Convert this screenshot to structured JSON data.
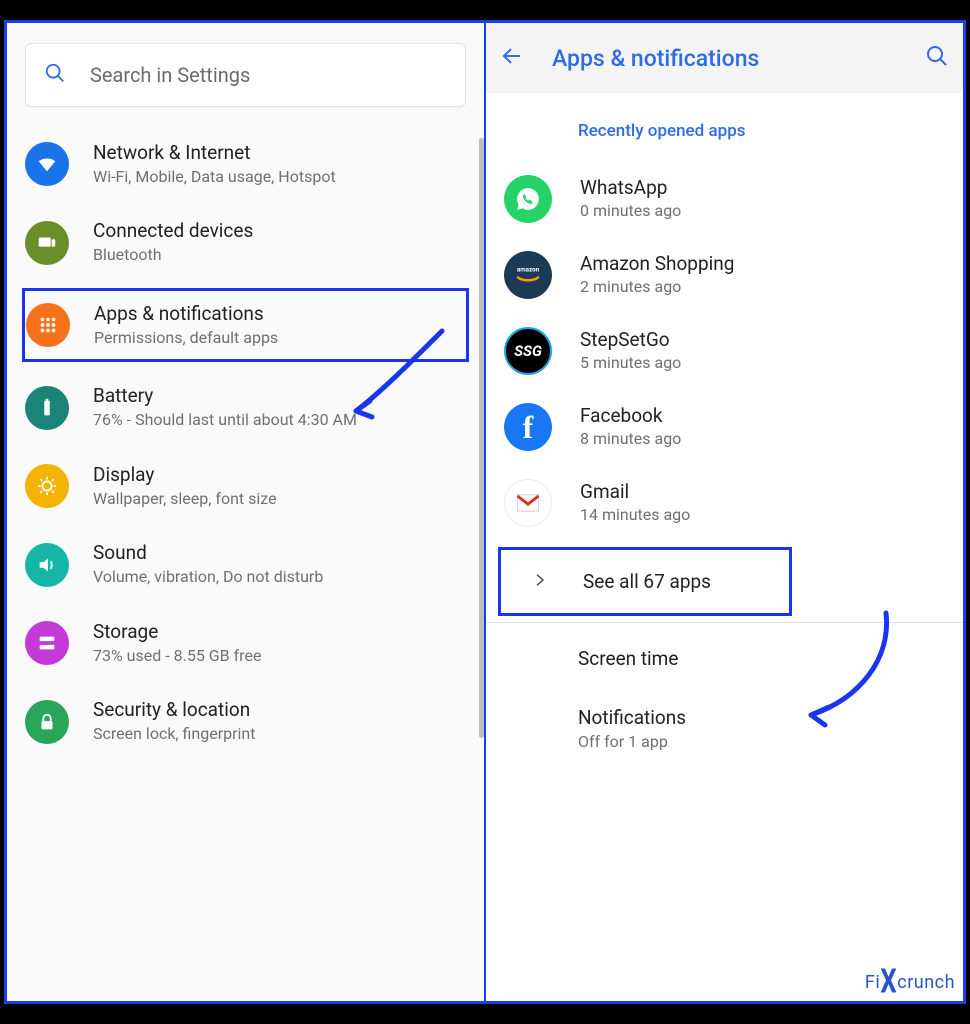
{
  "left": {
    "search_placeholder": "Search in Settings",
    "items": [
      {
        "title": "Network & Internet",
        "subtitle": "Wi-Fi, Mobile, Data usage, Hotspot"
      },
      {
        "title": "Connected devices",
        "subtitle": "Bluetooth"
      },
      {
        "title": "Apps & notifications",
        "subtitle": "Permissions, default apps"
      },
      {
        "title": "Battery",
        "subtitle": "76% - Should last until about 4:30 AM"
      },
      {
        "title": "Display",
        "subtitle": "Wallpaper, sleep, font size"
      },
      {
        "title": "Sound",
        "subtitle": "Volume, vibration, Do not disturb"
      },
      {
        "title": "Storage",
        "subtitle": "73% used - 8.55 GB free"
      },
      {
        "title": "Security & location",
        "subtitle": "Screen lock, fingerprint"
      }
    ]
  },
  "right": {
    "title": "Apps & notifications",
    "section_label": "Recently opened apps",
    "apps": [
      {
        "title": "WhatsApp",
        "subtitle": "0 minutes ago"
      },
      {
        "title": "Amazon Shopping",
        "subtitle": "2 minutes ago"
      },
      {
        "title": "StepSetGo",
        "subtitle": "5 minutes ago"
      },
      {
        "title": "Facebook",
        "subtitle": "8 minutes ago"
      },
      {
        "title": "Gmail",
        "subtitle": "14 minutes ago"
      }
    ],
    "see_all": "See all 67 apps",
    "screen_time": "Screen time",
    "notifications_title": "Notifications",
    "notifications_sub": "Off for 1 app"
  },
  "watermark": {
    "left": "Fi",
    "right": "crunch"
  }
}
